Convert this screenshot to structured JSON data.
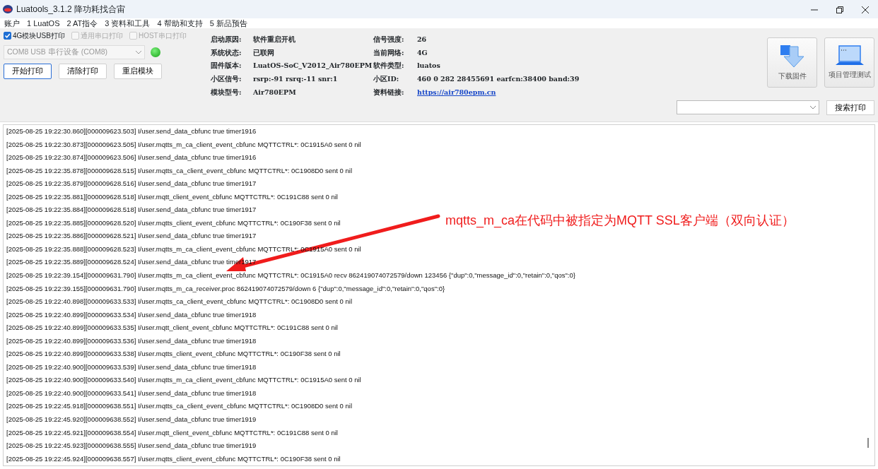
{
  "window": {
    "title": "Luatools_3.1.2 降功耗找合宙"
  },
  "menu": [
    "账户",
    "1 LuatOS",
    "2 AT指令",
    "3 资料和工具",
    "4 帮助和支持",
    "5 新品预告"
  ],
  "print_options": [
    {
      "label": "4G模块USB打印",
      "checked": true,
      "disabled": false
    },
    {
      "label": "通用串口打印",
      "checked": false,
      "disabled": true
    },
    {
      "label": "HOST串口打印",
      "checked": false,
      "disabled": true
    }
  ],
  "port": {
    "value": "COM8 USB 串行设备 (COM8)",
    "connected": true
  },
  "buttons": [
    {
      "label": "开始打印",
      "selected": true
    },
    {
      "label": "清除打印",
      "selected": false
    },
    {
      "label": "重启模块",
      "selected": false
    }
  ],
  "info_left": [
    {
      "label": "启动原因:",
      "value": "软件重启开机"
    },
    {
      "label": "系统状态:",
      "value": "已联网"
    },
    {
      "label": "固件版本:",
      "value": "LuatOS-SoC_V2012_Air780EPM"
    },
    {
      "label": "小区信号:",
      "value": "rsrp:-91 rsrq:-11 snr:1"
    },
    {
      "label": "模块型号:",
      "value": "Air780EPM"
    }
  ],
  "info_right": [
    {
      "label": "信号强度:",
      "value": "26",
      "kind": "text"
    },
    {
      "label": "当前网络:",
      "value": "4G",
      "kind": "text"
    },
    {
      "label": "软件类型:",
      "value": "luatos",
      "kind": "text"
    },
    {
      "label": "小区ID:",
      "value": "460 0 282 28455691 earfcn:38400 band:39",
      "kind": "text"
    },
    {
      "label": "资料链接:",
      "value": "https://air780epm.cn",
      "kind": "link"
    }
  ],
  "tool_buttons": [
    {
      "label": "下载固件",
      "kind": "download"
    },
    {
      "label": "项目管理测试",
      "kind": "laptop"
    }
  ],
  "search_button": "搜索打印",
  "log": [
    "[2025-08-25 19:22:30.860][000009623.503] I/user.send_data_cbfunc true timer1916",
    "[2025-08-25 19:22:30.873][000009623.505] I/user.mqtts_m_ca_client_event_cbfunc MQTTCTRL*: 0C1915A0 sent 0 nil",
    "[2025-08-25 19:22:30.874][000009623.506] I/user.send_data_cbfunc true timer1916",
    "[2025-08-25 19:22:35.878][000009628.515] I/user.mqtts_ca_client_event_cbfunc MQTTCTRL*: 0C1908D0 sent 0 nil",
    "[2025-08-25 19:22:35.879][000009628.516] I/user.send_data_cbfunc true timer1917",
    "[2025-08-25 19:22:35.881][000009628.518] I/user.mqtt_client_event_cbfunc MQTTCTRL*: 0C191C88 sent 0 nil",
    "[2025-08-25 19:22:35.884][000009628.518] I/user.send_data_cbfunc true timer1917",
    "[2025-08-25 19:22:35.885][000009628.520] I/user.mqtts_client_event_cbfunc MQTTCTRL*: 0C190F38 sent 0 nil",
    "[2025-08-25 19:22:35.886][000009628.521] I/user.send_data_cbfunc true timer1917",
    "[2025-08-25 19:22:35.888][000009628.523] I/user.mqtts_m_ca_client_event_cbfunc MQTTCTRL*: 0C1915A0 sent 0 nil",
    "[2025-08-25 19:22:35.889][000009628.524] I/user.send_data_cbfunc true timer1917",
    "[2025-08-25 19:22:39.154][000009631.790] I/user.mqtts_m_ca_client_event_cbfunc MQTTCTRL*: 0C1915A0 recv 862419074072579/down 123456 {\"dup\":0,\"message_id\":0,\"retain\":0,\"qos\":0}",
    "[2025-08-25 19:22:39.155][000009631.790] I/user.mqtts_m_ca_receiver.proc 862419074072579/down 6 {\"dup\":0,\"message_id\":0,\"retain\":0,\"qos\":0}",
    "[2025-08-25 19:22:40.898][000009633.533] I/user.mqtts_ca_client_event_cbfunc MQTTCTRL*: 0C1908D0 sent 0 nil",
    "[2025-08-25 19:22:40.899][000009633.534] I/user.send_data_cbfunc true timer1918",
    "[2025-08-25 19:22:40.899][000009633.535] I/user.mqtt_client_event_cbfunc MQTTCTRL*: 0C191C88 sent 0 nil",
    "[2025-08-25 19:22:40.899][000009633.536] I/user.send_data_cbfunc true timer1918",
    "[2025-08-25 19:22:40.899][000009633.538] I/user.mqtts_client_event_cbfunc MQTTCTRL*: 0C190F38 sent 0 nil",
    "[2025-08-25 19:22:40.900][000009633.539] I/user.send_data_cbfunc true timer1918",
    "[2025-08-25 19:22:40.900][000009633.540] I/user.mqtts_m_ca_client_event_cbfunc MQTTCTRL*: 0C1915A0 sent 0 nil",
    "[2025-08-25 19:22:40.900][000009633.541] I/user.send_data_cbfunc true timer1918",
    "[2025-08-25 19:22:45.918][000009638.551] I/user.mqtts_ca_client_event_cbfunc MQTTCTRL*: 0C1908D0 sent 0 nil",
    "[2025-08-25 19:22:45.920][000009638.552] I/user.send_data_cbfunc true timer1919",
    "[2025-08-25 19:22:45.921][000009638.554] I/user.mqtt_client_event_cbfunc MQTTCTRL*: 0C191C88 sent 0 nil",
    "[2025-08-25 19:22:45.923][000009638.555] I/user.send_data_cbfunc true timer1919",
    "[2025-08-25 19:22:45.924][000009638.557] I/user.mqtts_client_event_cbfunc MQTTCTRL*: 0C190F38 sent 0 nil"
  ],
  "annotation": {
    "text": "mqtts_m_ca在代码中被指定为MQTT SSL客户端（双向认证）"
  }
}
